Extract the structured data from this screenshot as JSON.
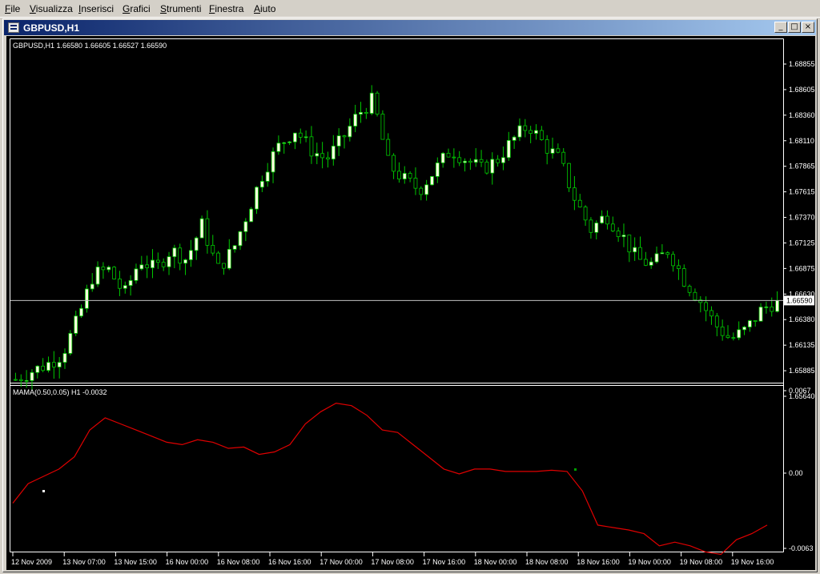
{
  "menu": [
    "File",
    "Visualizza",
    "Inserisci",
    "Grafici",
    "Strumenti",
    "Finestra",
    "Aiuto"
  ],
  "window": {
    "title": "GBPUSD,H1",
    "minimize_glyph": "_",
    "restore_glyph": "□",
    "close_glyph": "×"
  },
  "price_panel": {
    "info": "GBPUSD,H1  1.66580 1.66605 1.66527 1.66590",
    "current_price": "1.66590",
    "y_ticks": [
      "1.68855",
      "1.68605",
      "1.68360",
      "1.68110",
      "1.67865",
      "1.67615",
      "1.67370",
      "1.67125",
      "1.66875",
      "1.66630",
      "1.66380",
      "1.66135",
      "1.65885",
      "1.65640"
    ]
  },
  "indicator_panel": {
    "info": "MAMA(0.50,0.05) H1 -0.0032",
    "y_ticks": [
      "0.0067",
      "0.00",
      "-0.0063"
    ]
  },
  "x_ticks": [
    "12 Nov 2009",
    "13 Nov 07:00",
    "13 Nov 15:00",
    "16 Nov 00:00",
    "16 Nov 08:00",
    "16 Nov 16:00",
    "17 Nov 00:00",
    "17 Nov 08:00",
    "17 Nov 16:00",
    "18 Nov 00:00",
    "18 Nov 08:00",
    "18 Nov 16:00",
    "19 Nov 00:00",
    "19 Nov 08:00",
    "19 Nov 16:00"
  ],
  "colors": {
    "chart_bg": "#000000",
    "bull_candle": "#ffffe0",
    "bear_candle": "#000000",
    "candle_wick": "#00c800",
    "indicator_line": "#e00000",
    "grid_text": "#ffffff",
    "bid_line": "#c0c0c0"
  },
  "chart_data": [
    {
      "type": "candlestick",
      "series": [
        {
          "name": "GBPUSD,H1"
        }
      ],
      "ylim": [
        1.6564,
        1.6898
      ],
      "x": [
        "12 Nov 2009",
        "13 Nov 07:00",
        "13 Nov 15:00",
        "16 Nov 00:00",
        "16 Nov 08:00",
        "16 Nov 16:00",
        "17 Nov 00:00",
        "17 Nov 08:00",
        "17 Nov 16:00",
        "18 Nov 00:00",
        "18 Nov 08:00",
        "18 Nov 16:00",
        "19 Nov 00:00",
        "19 Nov 08:00",
        "19 Nov 16:00"
      ],
      "close_path": [
        1.658,
        1.6588,
        1.6595,
        1.6605,
        1.664,
        1.6685,
        1.669,
        1.6665,
        1.67,
        1.669,
        1.671,
        1.67,
        1.6735,
        1.669,
        1.671,
        1.675,
        1.679,
        1.6815,
        1.683,
        1.681,
        1.68,
        1.682,
        1.6845,
        1.686,
        1.6795,
        1.678,
        1.677,
        1.679,
        1.681,
        1.68,
        1.679,
        1.68,
        1.682,
        1.6835,
        1.6815,
        1.68,
        1.676,
        1.673,
        1.6745,
        1.6725,
        1.67,
        1.6695,
        1.671,
        1.668,
        1.666,
        1.6635,
        1.662,
        1.663,
        1.665,
        1.6659
      ],
      "last_price": 1.6659
    },
    {
      "type": "line",
      "series": [
        {
          "name": "MAMA(0.50,0.05)"
        }
      ],
      "ylim": [
        -0.0063,
        0.0067
      ],
      "values": [
        -0.002,
        -0.0004,
        0.0002,
        0.0008,
        0.0018,
        0.004,
        0.005,
        0.0045,
        0.004,
        0.0035,
        0.003,
        0.0028,
        0.0032,
        0.003,
        0.0025,
        0.0026,
        0.002,
        0.0022,
        0.0028,
        0.0045,
        0.0055,
        0.0062,
        0.006,
        0.0052,
        0.004,
        0.0038,
        0.0028,
        0.0018,
        0.0008,
        0.0004,
        0.0008,
        0.0008,
        0.0006,
        0.0006,
        0.0006,
        0.0007,
        0.0006,
        -0.001,
        -0.0038,
        -0.004,
        -0.0042,
        -0.0045,
        -0.0055,
        -0.0052,
        -0.0055,
        -0.006,
        -0.0062,
        -0.005,
        -0.0045,
        -0.0038
      ],
      "last_value": -0.0032
    }
  ]
}
